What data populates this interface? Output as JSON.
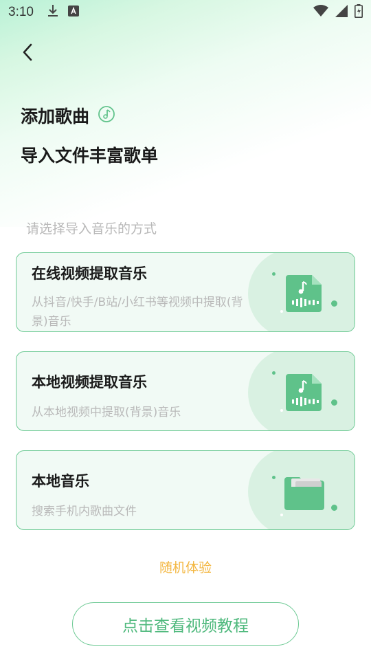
{
  "status_bar": {
    "time": "3:10",
    "icons": [
      "download-icon",
      "keyboard-a-icon",
      "wifi-icon",
      "signal-icon",
      "battery-charging-icon"
    ]
  },
  "header": {
    "title": "添加歌曲",
    "subtitle": "导入文件丰富歌单",
    "title_icon": "music-note-circle-icon"
  },
  "section": {
    "hint": "请选择导入音乐的方式"
  },
  "cards": [
    {
      "title": "在线视频提取音乐",
      "description": "从抖音/快手/B站/小红书等视频中提取(背景)音乐",
      "icon": "music-file-icon"
    },
    {
      "title": "本地视频提取音乐",
      "description": "从本地视频中提取(背景)音乐",
      "icon": "music-file-icon"
    },
    {
      "title": "本地音乐",
      "description": "搜索手机内歌曲文件",
      "icon": "folder-icon"
    }
  ],
  "random_link": "随机体验",
  "tutorial_button": "点击查看视频教程",
  "colors": {
    "accent": "#5fc28a",
    "card_border": "#6cc993",
    "link": "#f3b63f"
  }
}
